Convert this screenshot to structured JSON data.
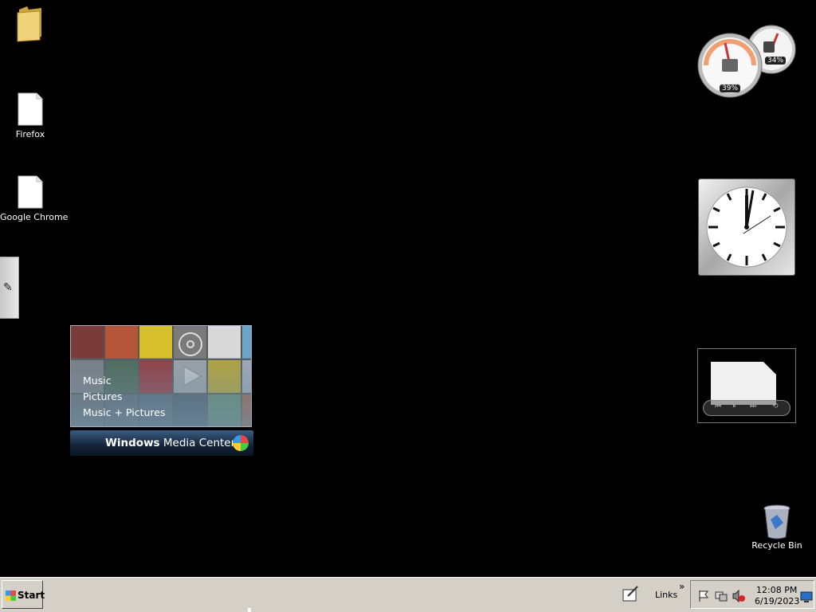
{
  "desktop": {
    "icons": [
      {
        "label": ""
      },
      {
        "label": "Firefox"
      },
      {
        "label": "Google Chrome"
      }
    ],
    "recycle_bin": "Recycle Bin"
  },
  "media_center": {
    "items": [
      "Music",
      "Pictures",
      "Music + Pictures"
    ],
    "title_bold": "Windows",
    "title_rest": " Media Center"
  },
  "cpu_meter": {
    "cpu_percent": "39%",
    "memory_percent": "34%",
    "cpu_value": 39,
    "memory_value": 34
  },
  "clock": {
    "time": "12:08"
  },
  "taskbar": {
    "start_label": "Start",
    "links_label": "Links",
    "chevron": "»",
    "time": "12:08 PM",
    "date": "6/19/2023"
  },
  "colors": {
    "desktop": "#000000",
    "taskbar": "#d4d0c8",
    "folder": "#e8c766",
    "wmc_bar": "#1a2c44"
  }
}
